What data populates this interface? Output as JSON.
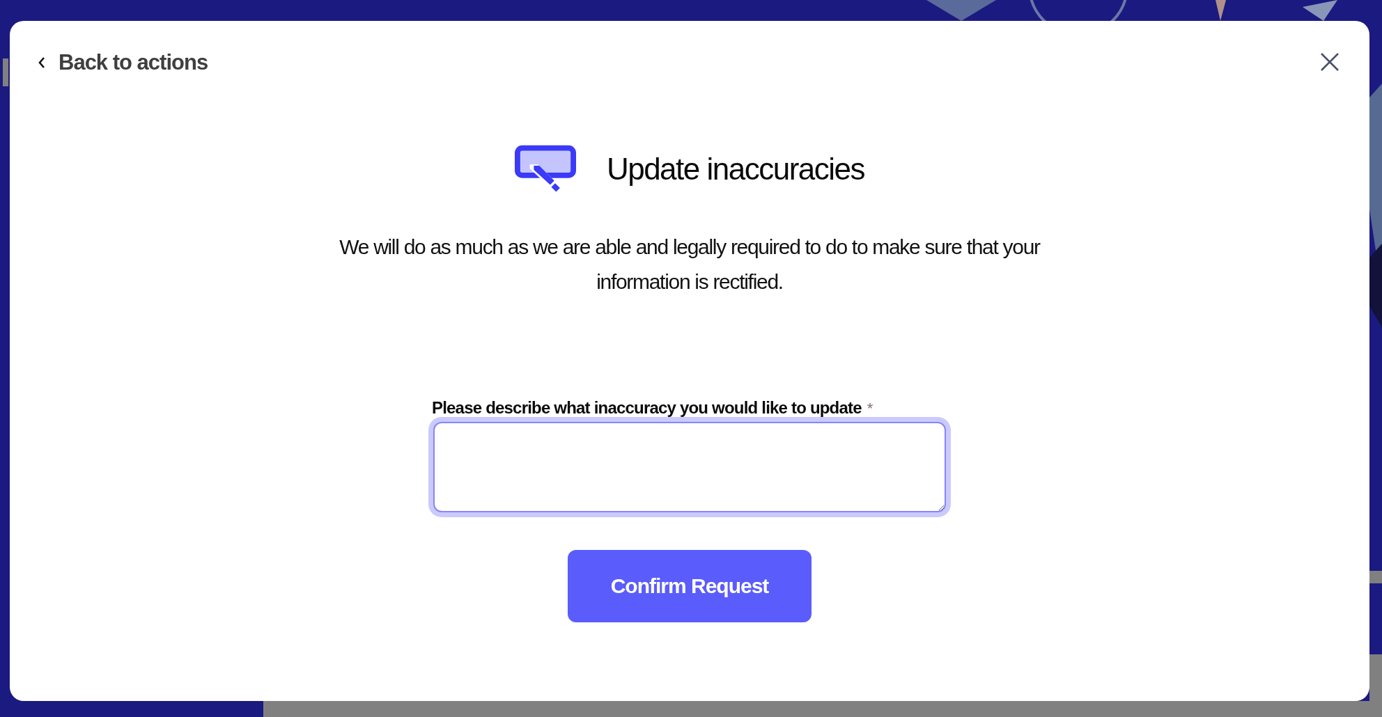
{
  "modal": {
    "back_link": "Back to actions",
    "title": "Update inaccuracies",
    "description": "We will do as much as we are able and legally required to do to make sure that your information is rectified.",
    "field": {
      "label": "Please describe what inaccuracy you would like to update",
      "required_mark": "*",
      "focused": true
    },
    "submit_button": "Confirm Request"
  }
}
